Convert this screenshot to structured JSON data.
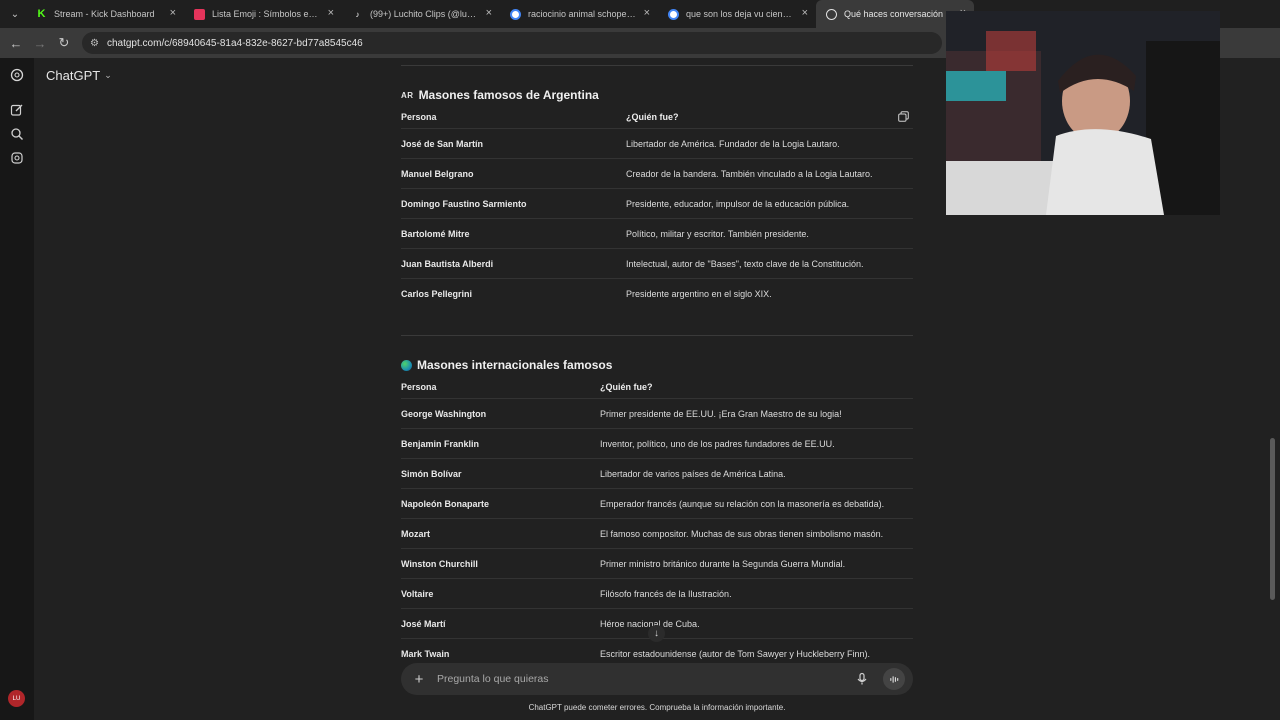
{
  "browser": {
    "tabs": [
      {
        "label": "Stream - Kick Dashboard",
        "favicon": "kick-icon",
        "color": "#53fc18",
        "active": false
      },
      {
        "label": "Lista Emoji : Símbolos emoji na",
        "favicon": "emoji-list-icon",
        "color": "#e5345b",
        "active": false
      },
      {
        "label": "(99+) Luchito Clips (@luchito.cl",
        "favicon": "tiktok-icon",
        "color": "#ffffff",
        "active": false
      },
      {
        "label": "raciocinio animal schopenhaue",
        "favicon": "google-icon",
        "color": "#4285f4",
        "active": false
      },
      {
        "label": "que son los deja vu cientificam",
        "favicon": "google-icon",
        "color": "#4285f4",
        "active": false
      },
      {
        "label": "Qué haces conversación",
        "favicon": "chatgpt-icon",
        "color": "#e0e0e0",
        "active": true
      }
    ],
    "url": "chatgpt.com/c/68940645-81a4-832e-8627-bd77a8545c46"
  },
  "app": {
    "model_label": "ChatGPT",
    "avatar_initials": "LU"
  },
  "sections": [
    {
      "badge": "AR",
      "title": "Masones famosos de Argentina",
      "header": {
        "col1": "Persona",
        "col2": "¿Quién fue?"
      },
      "rows": [
        {
          "person": "José de San Martín",
          "desc": "Libertador de América. Fundador de la Logia Lautaro."
        },
        {
          "person": "Manuel Belgrano",
          "desc": "Creador de la bandera. También vinculado a la Logia Lautaro."
        },
        {
          "person": "Domingo Faustino Sarmiento",
          "desc": "Presidente, educador, impulsor de la educación pública."
        },
        {
          "person": "Bartolomé Mitre",
          "desc": "Político, militar y escritor. También presidente."
        },
        {
          "person": "Juan Bautista Alberdi",
          "desc": "Intelectual, autor de \"Bases\", texto clave de la Constitución."
        },
        {
          "person": "Carlos Pellegrini",
          "desc": "Presidente argentino en el siglo XIX."
        }
      ]
    },
    {
      "badge": "globe",
      "title": "Masones internacionales famosos",
      "header": {
        "col1": "Persona",
        "col2": "¿Quién fue?"
      },
      "rows": [
        {
          "person": "George Washington",
          "desc": "Primer presidente de EE.UU. ¡Era Gran Maestro de su logia!"
        },
        {
          "person": "Benjamin Franklin",
          "desc": "Inventor, político, uno de los padres fundadores de EE.UU."
        },
        {
          "person": "Simón Bolívar",
          "desc": "Libertador de varios países de América Latina."
        },
        {
          "person": "Napoleón Bonaparte",
          "desc": "Emperador francés (aunque su relación con la masonería es debatida)."
        },
        {
          "person": "Mozart",
          "desc": "El famoso compositor. Muchas de sus obras tienen simbolismo masón."
        },
        {
          "person": "Winston Churchill",
          "desc": "Primer ministro británico durante la Segunda Guerra Mundial."
        },
        {
          "person": "Voltaire",
          "desc": "Filósofo francés de la Ilustración."
        },
        {
          "person": "José Martí",
          "desc": "Héroe nacional de Cuba."
        },
        {
          "person": "Mark Twain",
          "desc": "Escritor estadounidense (autor de Tom Sawyer y Huckleberry Finn)."
        }
      ]
    }
  ],
  "composer": {
    "placeholder": "Pregunta lo que quieras"
  },
  "disclaimer": "ChatGPT puede cometer errores. Comprueba la información importante."
}
